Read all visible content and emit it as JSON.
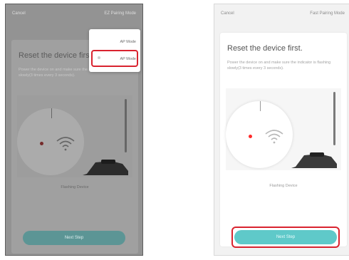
{
  "left_screen": {
    "topbar": {
      "cancel": "Cancel",
      "mode": "EZ Pairing Mode"
    },
    "card": {
      "title": "Reset the device first.",
      "description": "Power the device on and make sure the indicator is flashing slowly(3 times every 3 seconds).",
      "status": "Flashing Device"
    },
    "next_button": "Next Step",
    "dropdown": {
      "items": [
        {
          "label": "AP Mode"
        },
        {
          "label": "AP Mode"
        }
      ]
    }
  },
  "right_screen": {
    "topbar": {
      "cancel": "Cancel",
      "mode": "Fast Pairing Mode"
    },
    "card": {
      "title": "Reset the device first.",
      "description": "Power the device on and make sure the indicator is flashing slowly(3 times every 3 seconds).",
      "status": "Flashing Device"
    },
    "next_button": "Next Step"
  },
  "colors": {
    "accent": "#5fc9c9",
    "highlight": "#d9232f",
    "indicator": "#ff2a2a"
  },
  "icons": [
    "wifi-icon",
    "chevron-down-icon",
    "hand-icon"
  ]
}
